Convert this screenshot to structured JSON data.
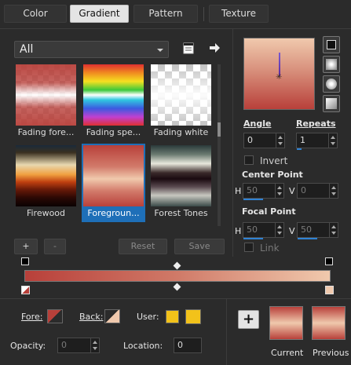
{
  "tabs": [
    {
      "label": "Color",
      "active": false
    },
    {
      "label": "Gradient",
      "active": true
    },
    {
      "label": "Pattern",
      "active": false
    },
    {
      "label": "Texture",
      "active": false
    }
  ],
  "library": {
    "filter": "All",
    "items": [
      {
        "label": "Fading fore..."
      },
      {
        "label": "Fading spe..."
      },
      {
        "label": "Fading white"
      },
      {
        "label": "Firewood"
      },
      {
        "label": "Foregroun...",
        "selected": true
      },
      {
        "label": "Forest Tones"
      }
    ],
    "add_label": "+",
    "remove_label": "-",
    "reset_label": "Reset",
    "save_label": "Save"
  },
  "controls": {
    "angle_label": "Angle",
    "angle_value": "0",
    "repeats_label": "Repeats",
    "repeats_value": "1",
    "invert_label": "Invert",
    "center_point_label": "Center Point",
    "center_h_label": "H",
    "center_h_value": "50",
    "center_v_label": "V",
    "center_v_value": "0",
    "focal_point_label": "Focal Point",
    "focal_h_label": "H",
    "focal_h_value": "50",
    "focal_v_label": "V",
    "focal_v_value": "50",
    "link_label": "Link"
  },
  "stops": {
    "fore_label": "Fore:",
    "back_label": "Back:",
    "user_label": "User:",
    "opacity_label": "Opacity:",
    "opacity_value": "0",
    "location_label": "Location:",
    "location_value": "0"
  },
  "swatches": {
    "add_label": "+",
    "current_label": "Current",
    "previous_label": "Previous"
  },
  "colors": {
    "gradient_start": "#b8403a",
    "gradient_end": "#f0c9ad",
    "user_color": "#f2c21a",
    "accent": "#2f82d4"
  }
}
